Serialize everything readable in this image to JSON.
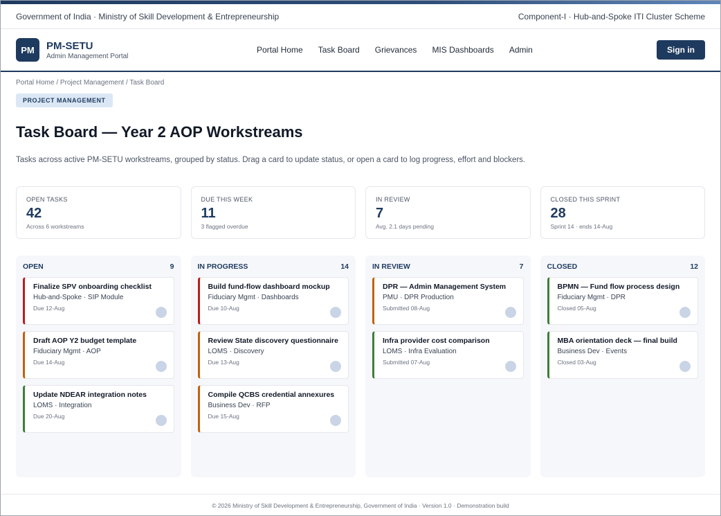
{
  "gov_strip": {
    "left": "Government of India · Ministry of Skill Development & Entrepreneurship",
    "right": "Component-I · Hub-and-Spoke ITI Cluster Scheme"
  },
  "header": {
    "logo_text": "PM",
    "brand_name": "PM-SETU",
    "brand_sub": "Admin Management Portal",
    "nav": [
      "Portal Home",
      "Task Board",
      "Grievances",
      "MIS Dashboards",
      "Admin"
    ],
    "signin_label": "Sign in"
  },
  "breadcrumb": "Portal Home / Project Management / Task Board",
  "section_pill": "PROJECT MANAGEMENT",
  "page_title": "Task Board — Year 2 AOP Workstreams",
  "page_desc": "Tasks across active PM-SETU workstreams, grouped by status. Drag a card to update status, or open a card to log progress, effort and blockers.",
  "stats": [
    {
      "label": "OPEN TASKS",
      "value": "42",
      "sub": "Across 6 workstreams"
    },
    {
      "label": "DUE THIS WEEK",
      "value": "11",
      "sub": "3 flagged overdue"
    },
    {
      "label": "IN REVIEW",
      "value": "7",
      "sub": "Avg. 2.1 days pending"
    },
    {
      "label": "CLOSED THIS SPRINT",
      "value": "28",
      "sub": "Sprint 14 · ends 14-Aug"
    }
  ],
  "columns": [
    {
      "title": "OPEN",
      "count": "9",
      "cards": [
        {
          "title": "Finalize SPV onboarding checklist",
          "meta": "Hub-and-Spoke · SIP Module",
          "due": "Due 12-Aug",
          "color": "#b91c1c"
        },
        {
          "title": "Draft AOP Y2 budget template",
          "meta": "Fiduciary Mgmt · AOP",
          "due": "Due 14-Aug",
          "color": "#c2610c"
        },
        {
          "title": "Update NDEAR integration notes",
          "meta": "LOMS · Integration",
          "due": "Due 20-Aug",
          "color": "#3f7d3a"
        }
      ]
    },
    {
      "title": "IN PROGRESS",
      "count": "14",
      "cards": [
        {
          "title": "Build fund-flow dashboard mockup",
          "meta": "Fiduciary Mgmt · Dashboards",
          "due": "Due 10-Aug",
          "color": "#b91c1c"
        },
        {
          "title": "Review State discovery questionnaire",
          "meta": "LOMS · Discovery",
          "due": "Due 13-Aug",
          "color": "#c2610c"
        },
        {
          "title": "Compile QCBS credential annexures",
          "meta": "Business Dev · RFP",
          "due": "Due 15-Aug",
          "color": "#c2610c"
        }
      ]
    },
    {
      "title": "IN REVIEW",
      "count": "7",
      "cards": [
        {
          "title": "DPR — Admin Management System",
          "meta": "PMU · DPR Production",
          "due": "Submitted 08-Aug",
          "color": "#c2610c"
        },
        {
          "title": "Infra provider cost comparison",
          "meta": "LOMS · Infra Evaluation",
          "due": "Submitted 07-Aug",
          "color": "#3f7d3a"
        }
      ]
    },
    {
      "title": "CLOSED",
      "count": "12",
      "cards": [
        {
          "title": "BPMN — Fund flow process design",
          "meta": "Fiduciary Mgmt · DPR",
          "due": "Closed 05-Aug",
          "color": "#3f7d3a"
        },
        {
          "title": "MBA orientation deck — final build",
          "meta": "Business Dev · Events",
          "due": "Closed 03-Aug",
          "color": "#3f7d3a"
        }
      ]
    }
  ],
  "footer": "© 2026 Ministry of Skill Development & Entrepreneurship, Government of India · Version 1.0 · Demonstration build"
}
